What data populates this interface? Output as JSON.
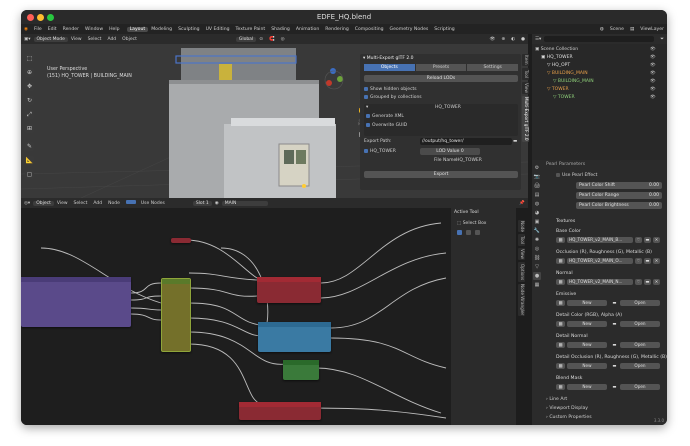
{
  "window": {
    "title": "EDFE_HQ.blend"
  },
  "menu": {
    "items": [
      "File",
      "Edit",
      "Render",
      "Window",
      "Help"
    ],
    "workspaces": [
      "Layout",
      "Modeling",
      "Sculpting",
      "UV Editing",
      "Texture Paint",
      "Shading",
      "Animation",
      "Rendering",
      "Compositing",
      "Geometry Nodes",
      "Scripting"
    ],
    "active_workspace": "Layout",
    "scene": "Scene",
    "view_layer": "ViewLayer"
  },
  "viewport": {
    "mode": "Object Mode",
    "menus": [
      "View",
      "Select",
      "Add",
      "Object"
    ],
    "transform": "Global",
    "options": "Options",
    "info_line1": "User Perspective",
    "info_line2": "(151) HQ_TOWER | BUILDING_MAIN"
  },
  "addon": {
    "title": "Multi-Export glTF 2.0",
    "tabs": [
      "Objects",
      "Presets",
      "Settings"
    ],
    "reload_lods": "Reload LODs",
    "show_hidden": "Show hidden objects",
    "grouped": "Grouped by collections",
    "collection": "HQ_TOWER",
    "generate_xml": "Generate XML",
    "overwrite_guid": "Overwrite GUID",
    "export_path_label": "Export Path:",
    "export_path": "//output/hq_tower/",
    "item_name": "HQ_TOWER",
    "lod_value": "LOD Value",
    "lod_number": "0",
    "file_name_label": "File Name:",
    "file_name": "HQ_TOWER",
    "export_btn": "Export",
    "side_tabs": [
      "Item",
      "Tool",
      "View",
      "Multi-Export glTF 2.0"
    ]
  },
  "outliner": {
    "title": "Scene Collection",
    "items": [
      {
        "label": "Scene Collection",
        "indent": 0,
        "color": "#cccccc"
      },
      {
        "label": "HQ_TOWER",
        "indent": 1,
        "color": "#e0e0e0"
      },
      {
        "label": "HQ_OPT",
        "indent": 2,
        "color": "#e0e0e0"
      },
      {
        "label": "BUILDING_MAIN",
        "indent": 2,
        "color": "#e8a04a"
      },
      {
        "label": "BUILDING_MAIN",
        "indent": 3,
        "color": "#8fd07a"
      },
      {
        "label": "TOWER",
        "indent": 2,
        "color": "#e8a04a"
      },
      {
        "label": "TOWER",
        "indent": 3,
        "color": "#8fd07a"
      }
    ]
  },
  "props": {
    "section_top": "Pearl Parameters",
    "use_pearl": "Use Pearl Effect",
    "pearl_fields": [
      {
        "label": "Pearl Color Shift",
        "value": "0.00"
      },
      {
        "label": "Pearl Color Range",
        "value": "0.00"
      },
      {
        "label": "Pearl Color Brightness",
        "value": "0.00"
      }
    ],
    "textures_label": "Textures",
    "slots": [
      {
        "label": "Base Color",
        "texture": "HQ_TOWER_v2_MAIN_B..."
      },
      {
        "label": "Occlusion (R), Roughness (G), Metallic (B)",
        "texture": "HQ_TOWER_v2_MAIN_O..."
      },
      {
        "label": "Normal",
        "texture": "HQ_TOWER_v2_MAIN_N..."
      }
    ],
    "empty_slots": [
      {
        "label": "Emissive"
      },
      {
        "label": "Detail Color (RGB), Alpha (A)"
      },
      {
        "label": "Detail Normal"
      },
      {
        "label": "Detail Occlusion (R), Roughness (G), Metallic (B)"
      },
      {
        "label": "Blend Mask"
      }
    ],
    "new_label": "New",
    "open_label": "Open",
    "collapsed": [
      "Line Art",
      "Viewport Display",
      "Custom Properties"
    ],
    "side_tabs": [
      "Tool",
      "Render",
      "Output",
      "View Layer",
      "Scene",
      "World",
      "Object",
      "Modifiers",
      "Particles",
      "Physics",
      "Constraints",
      "Data",
      "Material",
      "Texture"
    ]
  },
  "node_editor": {
    "editor": "Object",
    "menus": [
      "View",
      "Select",
      "Add",
      "Node"
    ],
    "use_nodes": "Use Nodes",
    "slot": "Slot 1",
    "material": "MAIN",
    "breadcrumb": [
      "BUILDING_MAIN",
      "BUILDING_MAIN",
      "MAIN"
    ],
    "active_tool": "Active Tool",
    "select_box": "Select Box",
    "side_tabs": [
      "Node",
      "Tool",
      "View",
      "Options",
      "Node Wrangler"
    ]
  },
  "status": {
    "version": "3.3.0"
  },
  "colors": {
    "accent": "#4772b3",
    "bg": "#1d1d1d",
    "panel": "#303030"
  }
}
